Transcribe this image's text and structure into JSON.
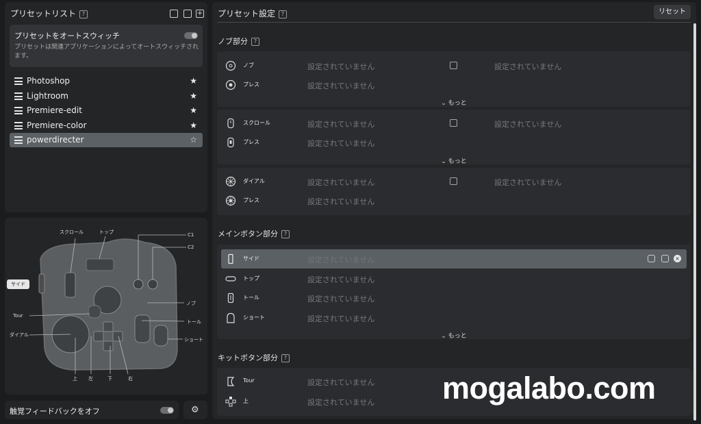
{
  "left": {
    "title": "プリセットリスト",
    "auto_switch": {
      "title": "プリセットをオートスウィッチ",
      "desc": "プリセットは関連アプリケーションによってオートスウィッチされます。"
    },
    "presets": [
      {
        "name": "Photoshop",
        "star": "★"
      },
      {
        "name": "Lightroom",
        "star": "★"
      },
      {
        "name": "Premiere-edit",
        "star": "★"
      },
      {
        "name": "Premiere-color",
        "star": "★"
      },
      {
        "name": "powerdirecter",
        "star": "☆"
      }
    ],
    "device_labels": {
      "scroll": "スクロール",
      "top": "トップ",
      "c1": "C1",
      "c2": "C2",
      "side": "サイド",
      "knob": "ノブ",
      "tour": "Tour",
      "toll": "トール",
      "dial": "ダイアル",
      "short": "ショート",
      "up": "上",
      "left": "左",
      "down": "下",
      "right": "右"
    },
    "haptic": "触覚フィードバックをオフ"
  },
  "right": {
    "title": "プリセット設定",
    "reset": "リセット",
    "sections": {
      "knob": "ノブ部分",
      "main": "メインボタン部分",
      "kit": "キットボタン部分"
    },
    "unset": "設定されていません",
    "more": "もっと",
    "knob_rows": [
      {
        "label": "ノブ"
      },
      {
        "label": "プレス"
      },
      {
        "label": "スクロール"
      },
      {
        "label": "プレス"
      },
      {
        "label": "ダイアル"
      },
      {
        "label": "プレス"
      }
    ],
    "main_rows": [
      {
        "label": "サイド"
      },
      {
        "label": "トップ"
      },
      {
        "label": "トール"
      },
      {
        "label": "ショート"
      }
    ],
    "kit_rows": [
      {
        "label": "Tour"
      },
      {
        "label": "上"
      }
    ]
  },
  "watermark": "mogalabo.com"
}
